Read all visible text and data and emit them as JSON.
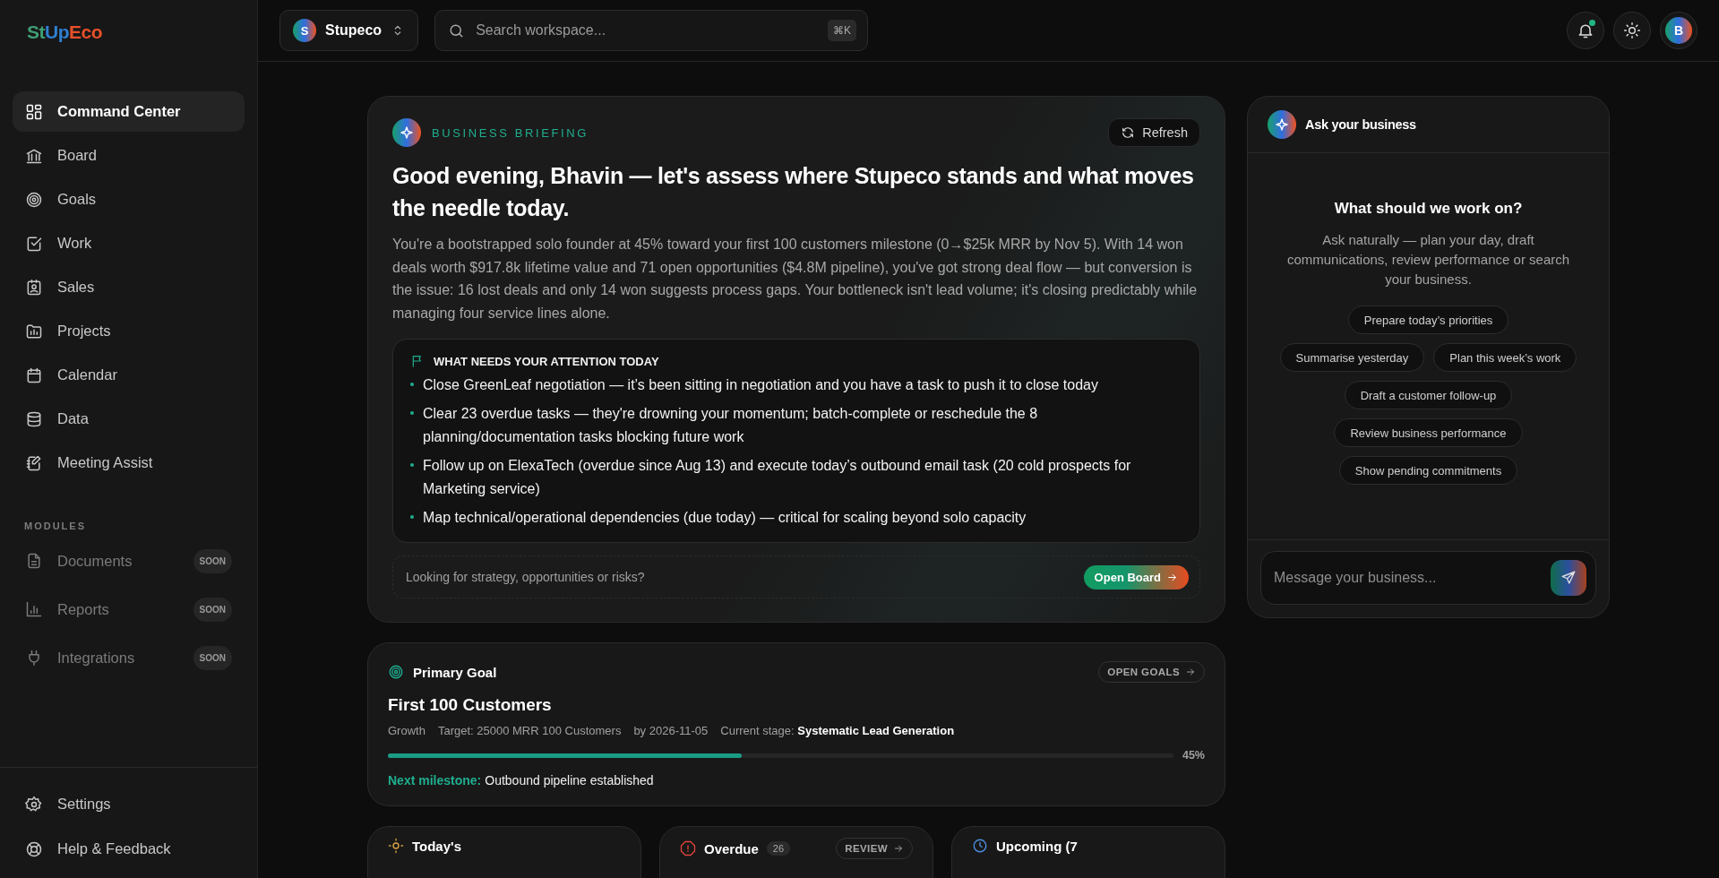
{
  "brand": {
    "logo": [
      {
        "text": "St",
        "color": "#3f9e74"
      },
      {
        "text": "Up",
        "color": "#2f7fd0"
      },
      {
        "text": "Eco",
        "color": "#e8502a"
      }
    ]
  },
  "sidebar": {
    "items": [
      {
        "label": "Command Center",
        "selected": true
      },
      {
        "label": "Board",
        "selected": false
      },
      {
        "label": "Goals",
        "selected": false
      },
      {
        "label": "Work",
        "selected": false
      },
      {
        "label": "Sales",
        "selected": false
      },
      {
        "label": "Projects",
        "selected": false
      },
      {
        "label": "Calendar",
        "selected": false
      },
      {
        "label": "Data",
        "selected": false
      },
      {
        "label": "Meeting Assist",
        "selected": false
      }
    ],
    "modules_heading": "MODULES",
    "modules": [
      {
        "label": "Documents",
        "badge": "SOON",
        "disabled": true
      },
      {
        "label": "Reports",
        "badge": "SOON",
        "disabled": true
      },
      {
        "label": "Integrations",
        "badge": "SOON",
        "disabled": true
      }
    ],
    "footer_items": [
      {
        "label": "Settings"
      },
      {
        "label": "Help & Feedback"
      }
    ]
  },
  "topbar": {
    "workspace": {
      "initial": "S",
      "name": "Stupeco"
    },
    "search": {
      "placeholder": "Search workspace...",
      "shortcut": "⌘K"
    },
    "notifications": {
      "unread": true
    },
    "avatar": {
      "initial": "B"
    }
  },
  "briefing": {
    "eyebrow": "BUSINESS BRIEFING",
    "refresh": "Refresh",
    "heading": "Good evening, Bhavin — let's assess where Stupeco stands and what moves the needle today.",
    "summary": "You're a bootstrapped solo founder at 45% toward your first 100 customers milestone (0→$25k MRR by Nov 5). With 14 won deals worth $917.8k lifetime value and 71 open opportunities ($4.8M pipeline), you've got strong deal flow — but conversion is the issue: 16 lost deals and only 14 won suggests process gaps. Your bottleneck isn't lead volume; it's closing predictably while managing four service lines alone.",
    "attention": {
      "title": "WHAT NEEDS YOUR ATTENTION TODAY",
      "items": [
        "Close GreenLeaf negotiation — it’s been sitting in negotiation and you have a task to push it to close today",
        "Clear 23 overdue tasks — they're drowning your momentum; batch-complete or reschedule the 8 planning/documentation tasks blocking future work",
        "Follow up on ElexaTech (overdue since Aug 13) and execute today’s outbound email task (20 cold prospects for Marketing service)",
        "Map technical/operational dependencies (due today) — critical for scaling beyond solo capacity"
      ]
    },
    "prompt": "Looking for strategy, opportunities or risks?",
    "button": "Open Board"
  },
  "goal": {
    "label": "Primary Goal",
    "button": "OPEN GOALS",
    "title": "First 100 Customers",
    "category": "Growth",
    "target": "Target: 25000 MRR 100 Customers",
    "deadline": "by 2026-11-05",
    "stage": "Current stage: **Systematic Lead Generation**",
    "level": 0.45,
    "reading": "45%",
    "milestone_label": "Next milestone:",
    "milestone": "Outbound pipeline established"
  },
  "cards": [
    {
      "kind": "today",
      "title": "Today's"
    },
    {
      "kind": "overdue",
      "title": "Overdue",
      "count": "26",
      "button": "REVIEW"
    },
    {
      "kind": "upcoming",
      "title": "Upcoming (7"
    }
  ],
  "assistant": {
    "title": "Ask your business",
    "heading": "What should we work on?",
    "description": "Ask naturally — plan your day, draft communications, review performance or search your business.",
    "suggestions": [
      "Prepare today’s priorities",
      "Summarise yesterday",
      "Plan this week’s work",
      "Draft a customer follow-up",
      "Review business performance",
      "Show pending commitments"
    ],
    "input": {
      "placeholder": "Message your business..."
    }
  }
}
